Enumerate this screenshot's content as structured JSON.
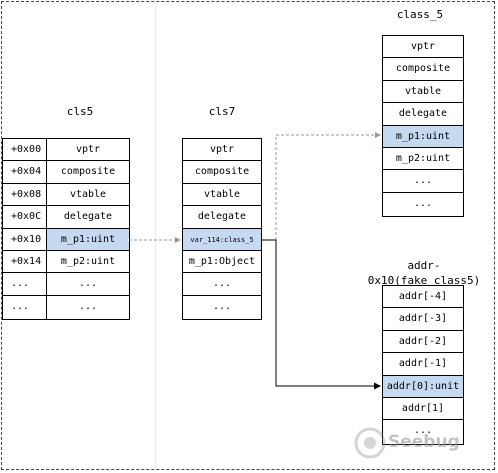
{
  "titles": {
    "cls5": "cls5",
    "cls7": "cls7",
    "class5": "class_5",
    "fake": "addr-0x10(fake_class5)"
  },
  "cls5": {
    "offsets": [
      "+0x00",
      "+0x04",
      "+0x08",
      "+0x0C",
      "+0x10",
      "+0x14",
      "...",
      "..."
    ],
    "fields": [
      "vptr",
      "composite",
      "vtable",
      "delegate",
      "m_p1:uint",
      "m_p2:uint",
      "...",
      "..."
    ]
  },
  "cls7": {
    "fields": [
      "vptr",
      "composite",
      "vtable",
      "delegate",
      "var_114:class_5",
      "m_p1:Object",
      "...",
      "..."
    ]
  },
  "class5": {
    "fields": [
      "vptr",
      "composite",
      "vtable",
      "delegate",
      "m_p1:uint",
      "m_p2:uint",
      "...",
      "..."
    ]
  },
  "fake": {
    "fields": [
      "addr[-4]",
      "addr[-3]",
      "addr[-2]",
      "addr[-1]",
      "addr[0]:unit",
      "addr[1]",
      "..."
    ]
  },
  "watermark": "Seebug",
  "colors": {
    "highlight": "#c5d9f1",
    "line": "#000000",
    "dashed_arrow": "#9a9a9a"
  }
}
